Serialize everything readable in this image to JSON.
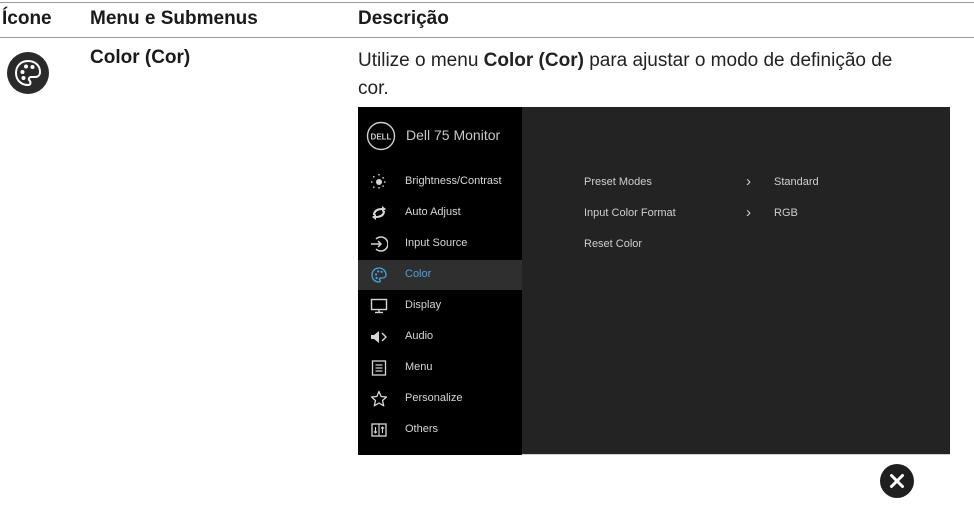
{
  "table": {
    "headers": {
      "icon": "Ícone",
      "menu": "Menu e Submenus",
      "description": "Descrição"
    },
    "row": {
      "icon_name": "color-palette-icon",
      "menu_name": "Color (Cor)",
      "desc_pre": "Utilize o menu ",
      "desc_bold": "Color (Cor)",
      "desc_post": " para ajustar o modo de definição de cor."
    }
  },
  "osd": {
    "title": "Dell 75 Monitor",
    "active_color": "#4aa3df",
    "nav": [
      {
        "label": "Brightness/Contrast",
        "icon": "brightness-icon"
      },
      {
        "label": "Auto Adjust",
        "icon": "auto-adjust-icon"
      },
      {
        "label": "Input Source",
        "icon": "input-source-icon"
      },
      {
        "label": "Color",
        "icon": "color-icon",
        "active": true
      },
      {
        "label": "Display",
        "icon": "display-icon"
      },
      {
        "label": "Audio",
        "icon": "audio-icon"
      },
      {
        "label": "Menu",
        "icon": "menu-icon"
      },
      {
        "label": "Personalize",
        "icon": "star-icon"
      },
      {
        "label": "Others",
        "icon": "others-icon"
      }
    ],
    "options": [
      {
        "label": "Preset Modes",
        "arrow": "›",
        "value": "Standard"
      },
      {
        "label": "Input Color Format",
        "arrow": "›",
        "value": "RGB"
      },
      {
        "label": "Reset Color"
      }
    ]
  },
  "close_icon": "close-icon"
}
